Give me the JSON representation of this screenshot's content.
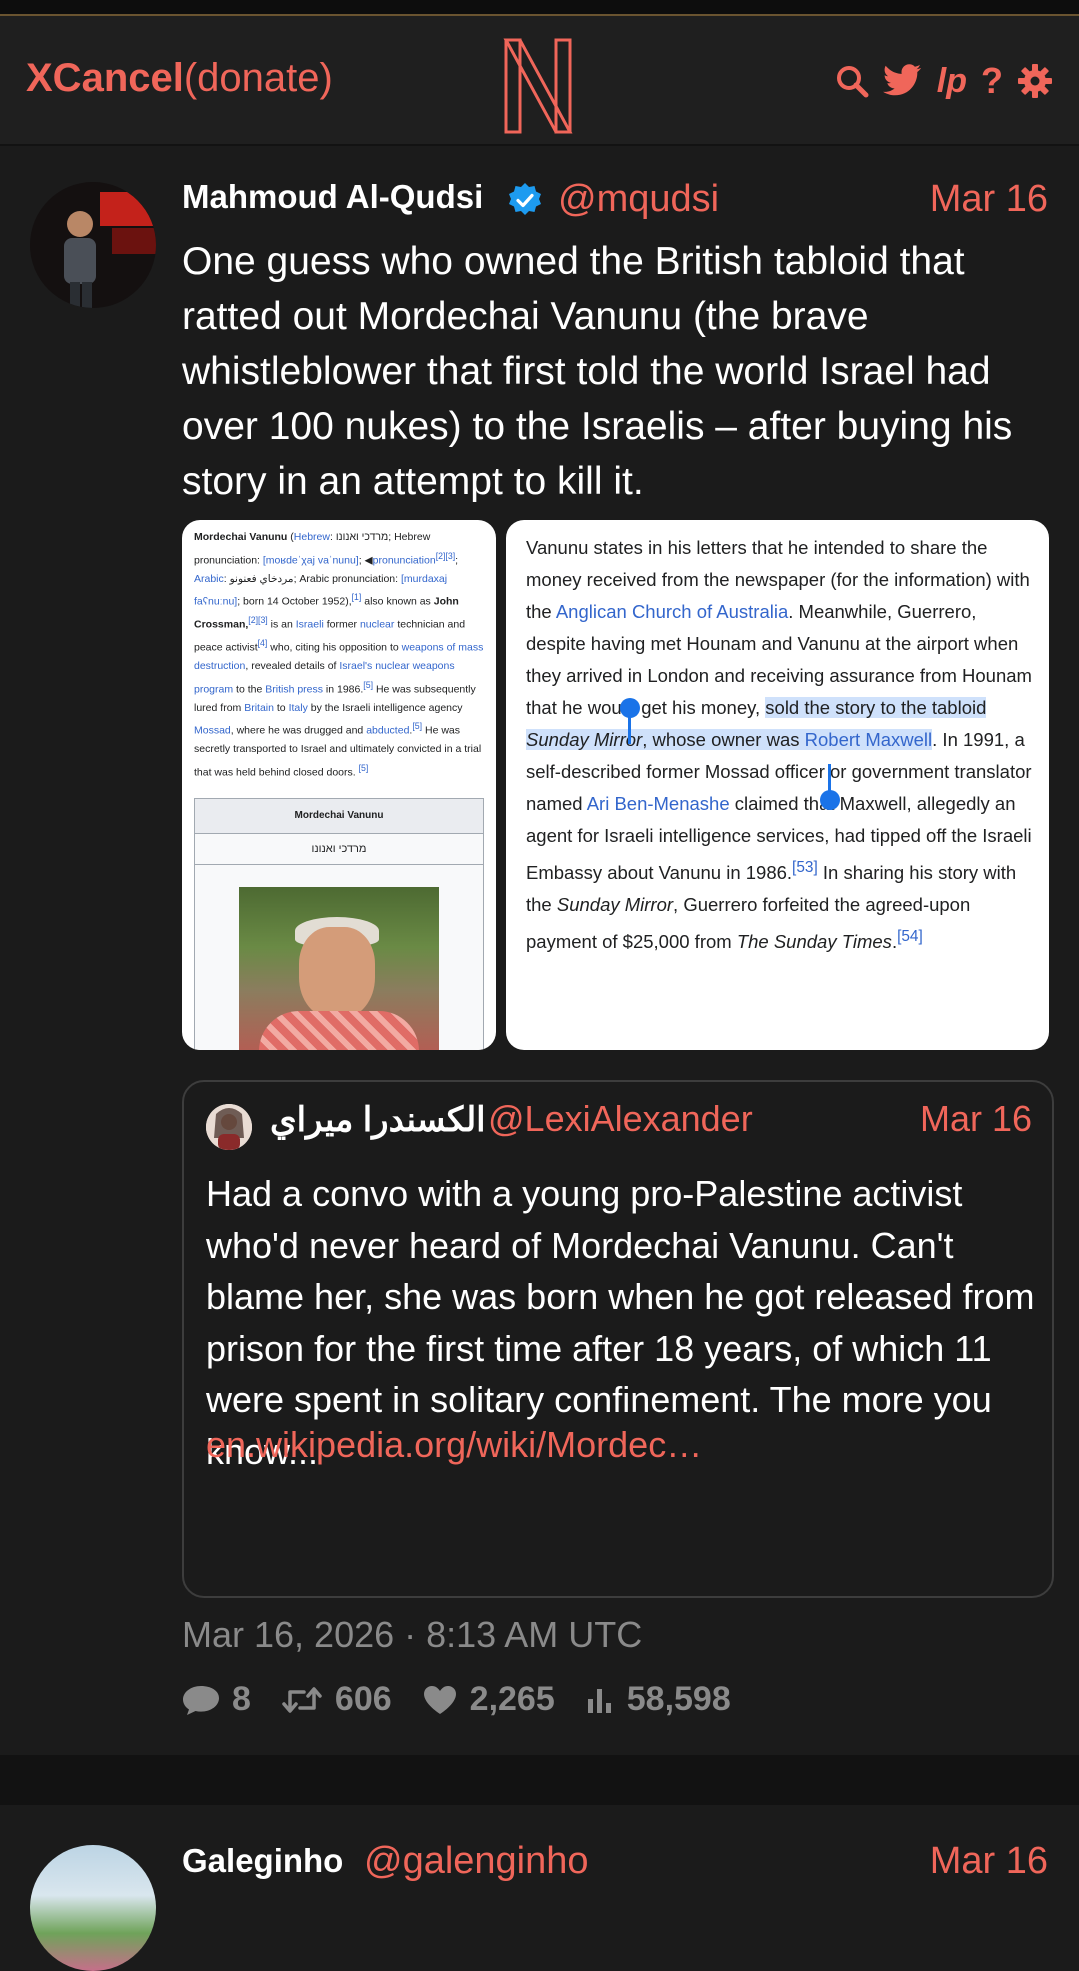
{
  "header": {
    "brand": "XCancel",
    "donate": "(donate)",
    "icons": [
      "search-icon",
      "twitter-bird-icon",
      "lp-icon",
      "help-icon",
      "settings-gear-icon"
    ],
    "lp_label": "lp",
    "help_label": "?"
  },
  "colors": {
    "accent": "#f0665a",
    "background": "#1b1b1b",
    "highlight": "#cfe1fb",
    "link_blue": "#3366cc"
  },
  "tweet": {
    "author_name": "Mahmoud Al-Qudsi",
    "verified": true,
    "handle": "@mqudsi",
    "date": "Mar 16",
    "text": "One guess who owned the British tabloid that ratted out Mordechai Vanunu (the brave whistleblower that first told the world Israel had over 100 nukes) to the Israelis – after buying his story in an attempt to kill it.",
    "timestamp": "Mar 16, 2026 · 8:13 AM UTC",
    "stats": {
      "replies": "8",
      "retweets": "606",
      "likes": "2,265",
      "views": "58,598"
    },
    "images": {
      "left": {
        "title": "Mordechai Vanunu",
        "hebrew_inline": "מרדכי ואנונו",
        "hebrew_label": "Hebrew",
        "hebrew_pron_label": "Hebrew pronunciation:",
        "hebrew_pron": "[moʁdeˈχaj vaˈnunu]",
        "pron_link": "pronunciation",
        "arabic_label": "Arabic",
        "arabic": "مردخاي فعنونو",
        "arabic_pron_label": "Arabic pronunciation:",
        "arabic_pron_a": "[murdaxaj",
        "arabic_pron_b": "faʕnuːnu]",
        "born": "; born 14 October 1952),",
        "also": " also known as",
        "alias": "John Crossman,",
        "is_an": " is an ",
        "israeli": "Israeli",
        "former": " former ",
        "nuclear": "nuclear",
        "tech": "technician and peace activist",
        "who": " who, citing his",
        "opp": "opposition to ",
        "wmd": "weapons of mass destruction",
        "revealed": ", revealed",
        "details": "details of ",
        "program": "Israel's nuclear weapons program",
        "to_the": " to the",
        "press": "British press",
        "in1986": " in 1986.",
        "lured": " He was subsequently lured",
        "from": "from ",
        "britain": "Britain",
        "to": " to ",
        "italy": "Italy",
        "by": " by the Israeli intelligence agency",
        "mossad": "Mossad",
        "drugged": ", where he was drugged and ",
        "abducted": "abducted",
        "he_was": " He",
        "secretly": "was secretly transported to Israel and ultimately",
        "convicted": "convicted in a trial that was held behind closed doors.",
        "refs": [
          "[2][3]",
          "[4]",
          "[5]",
          "[6]",
          "[5]"
        ],
        "ref1": "[1]",
        "infobox_title": "Mordechai Vanunu",
        "infobox_hebrew": "מרדכי ואנונו"
      },
      "right": {
        "p1": "Vanunu states in his letters that he intended to share the money received from the newspaper (for the information) with the ",
        "anglican": "Anglican Church of Australia",
        "p2": ". Meanwhile, Guerrero, despite having met Hounam and Vanunu at the airport when they arrived in London and receiving assurance from Hounam that he would get his money, ",
        "hl1": "sold the story to the tabloid ",
        "hl_italic": "Sunday Mirror",
        "hl2": ", whose owner was ",
        "maxwell": "Robert Maxwell",
        "p3": ". In 1991, a self-described former Mossad officer or government translator named ",
        "ari": "Ari Ben-Menashe",
        "p4": " claimed that Maxwell, allegedly an agent for Israeli intelligence services, had tipped off the Israeli Embassy about Vanunu in 1986.",
        "ref53": "[53]",
        "p5": " In sharing his story with the ",
        "sunday_mirror_2": "Sunday Mirror",
        "p6": ", Guerrero forfeited the agreed-upon payment of $25,000 from ",
        "times": "The Sunday Times",
        "p7": ".",
        "ref54": "[54]"
      }
    },
    "quote": {
      "author_name": "الكسندرا ميراي",
      "handle": "@LexiAlexander",
      "date": "Mar 16",
      "text": "Had a convo with a young pro-Palestine activist who'd never heard of Mordechai Vanunu. Can't blame her, she was born when he got released from prison for the first time after 18 years, of which 11 were spent in solitary confinement. The more you know...",
      "link": "en.wikipedia.org/wiki/Mordec…"
    }
  },
  "next_tweet": {
    "author_name": "Galeginho",
    "handle": "@galenginho",
    "date": "Mar 16"
  }
}
